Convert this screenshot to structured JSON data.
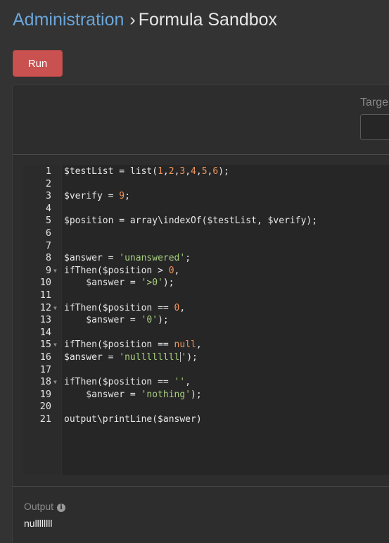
{
  "breadcrumb": {
    "parent": "Administration",
    "separator": "›",
    "current": "Formula Sandbox"
  },
  "toolbar": {
    "run_label": "Run",
    "run_color": "#c9514f"
  },
  "target": {
    "label": "Targe"
  },
  "editor": {
    "lines": [
      {
        "no": "1",
        "fold": false,
        "text": "$testList = list(1,2,3,4,5,6);"
      },
      {
        "no": "2",
        "fold": false,
        "text": ""
      },
      {
        "no": "3",
        "fold": false,
        "text": "$verify = 9;"
      },
      {
        "no": "4",
        "fold": false,
        "text": ""
      },
      {
        "no": "5",
        "fold": false,
        "text": "$position = array\\indexOf($testList, $verify);"
      },
      {
        "no": "6",
        "fold": false,
        "text": ""
      },
      {
        "no": "7",
        "fold": false,
        "text": ""
      },
      {
        "no": "8",
        "fold": false,
        "text": "$answer = 'unanswered';"
      },
      {
        "no": "9",
        "fold": true,
        "text": "ifThen($position > 0,"
      },
      {
        "no": "10",
        "fold": false,
        "text": "    $answer = '>0');"
      },
      {
        "no": "11",
        "fold": false,
        "text": ""
      },
      {
        "no": "12",
        "fold": true,
        "text": "ifThen($position == 0,"
      },
      {
        "no": "13",
        "fold": false,
        "text": "    $answer = '0');"
      },
      {
        "no": "14",
        "fold": false,
        "text": ""
      },
      {
        "no": "15",
        "fold": true,
        "text": "ifThen($position == null,"
      },
      {
        "no": "16",
        "fold": false,
        "text": "$answer = 'nullllllll');"
      },
      {
        "no": "17",
        "fold": false,
        "text": ""
      },
      {
        "no": "18",
        "fold": true,
        "text": "ifThen($position == '',"
      },
      {
        "no": "19",
        "fold": false,
        "text": "    $answer = 'nothing');"
      },
      {
        "no": "20",
        "fold": false,
        "text": ""
      },
      {
        "no": "21",
        "fold": false,
        "text": "output\\printLine($answer)"
      }
    ]
  },
  "output": {
    "label": "Output",
    "info_icon": "info-circle-icon",
    "value": "nullllllll"
  }
}
